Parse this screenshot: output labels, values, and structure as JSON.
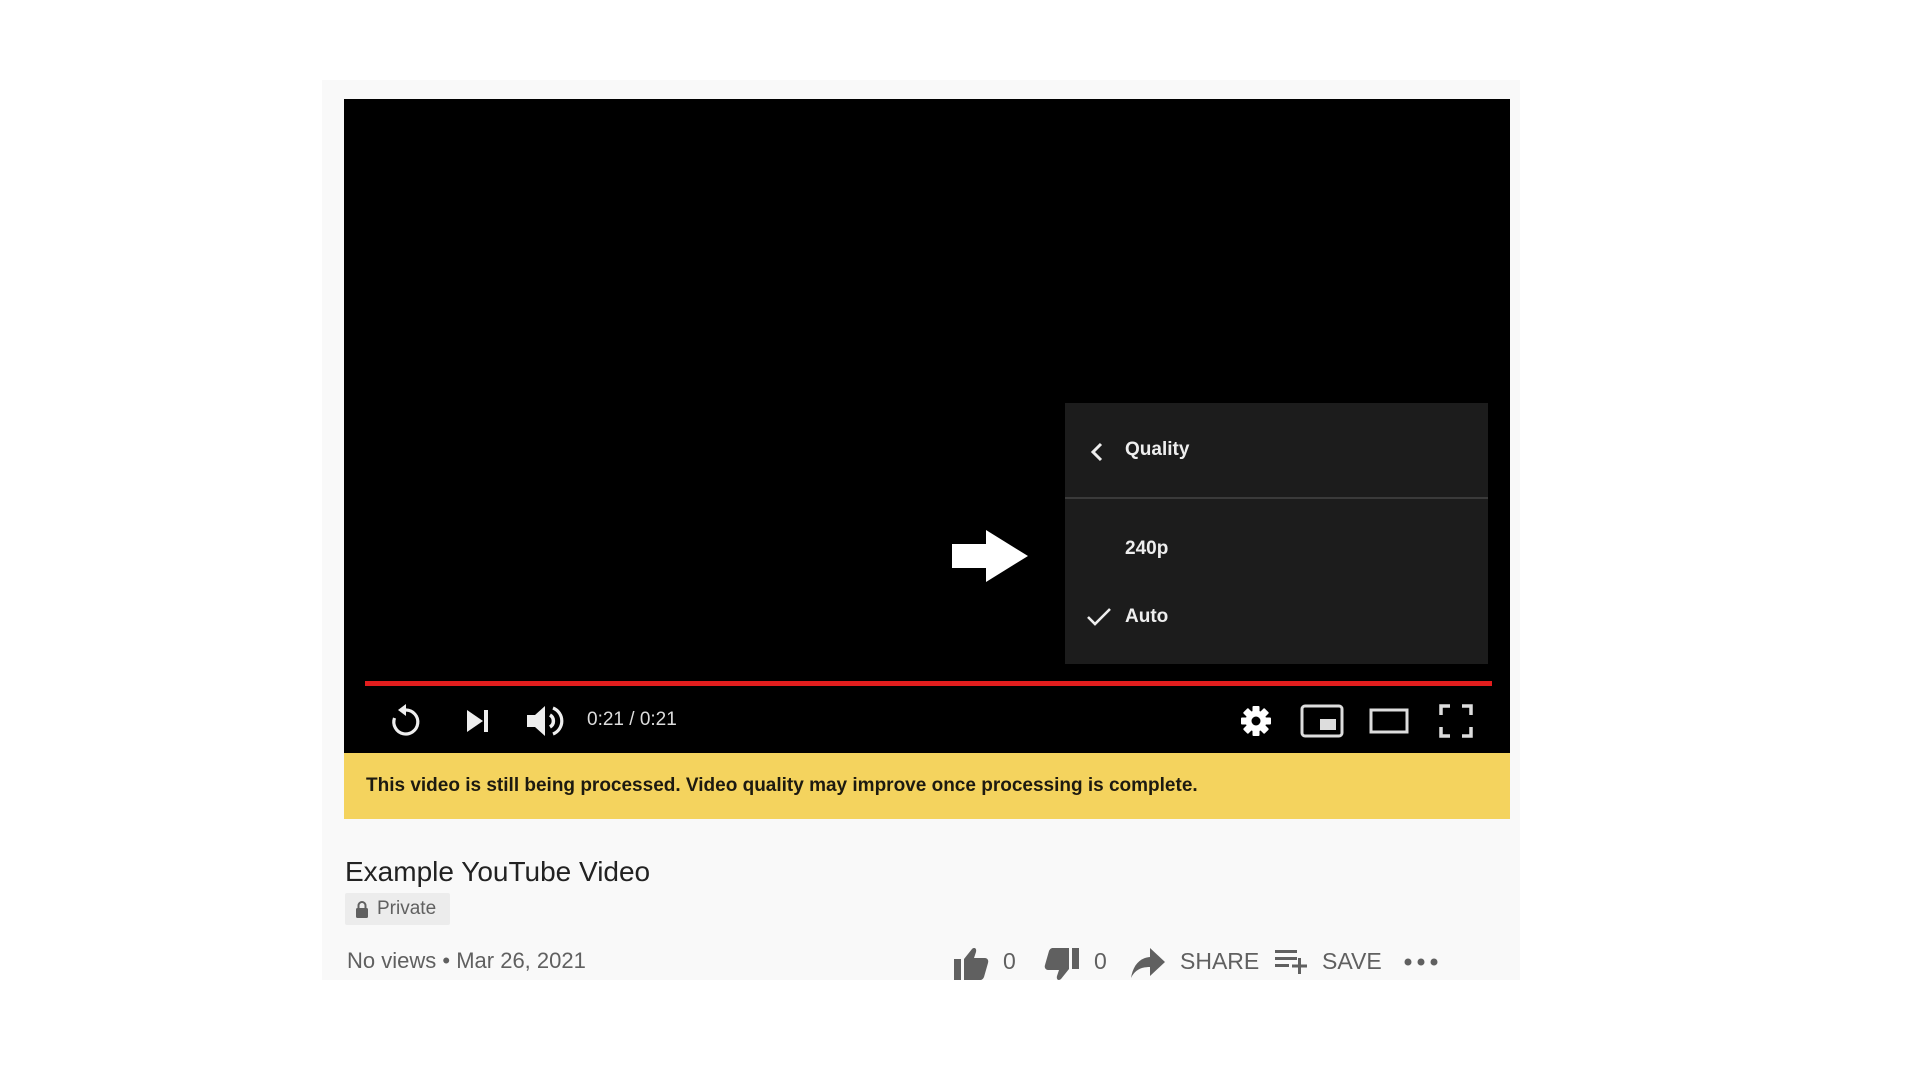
{
  "player": {
    "quality_menu": {
      "title": "Quality",
      "back_icon": "chevron-left-icon",
      "options": [
        {
          "label": "240p",
          "selected": false
        },
        {
          "label": "Auto",
          "selected": true
        }
      ]
    },
    "pointer_annotation": "arrow-right-icon",
    "progress": {
      "played_fraction": 1.0,
      "color": "#e21d1d"
    },
    "controls": {
      "replay_icon": "replay-icon",
      "next_icon": "skip-next-icon",
      "volume_icon": "volume-up-icon",
      "time": "0:21 / 0:21",
      "settings_icon": "gear-icon",
      "miniplayer_icon": "miniplayer-icon",
      "theater_icon": "theater-mode-icon",
      "fullscreen_icon": "fullscreen-icon"
    }
  },
  "notice": {
    "text": "This video is still being processed. Video quality may improve once processing is complete.",
    "color": "#f4d35e"
  },
  "video": {
    "title": "Example YouTube Video",
    "privacy": "Private",
    "views": "No views",
    "separator": "•",
    "date": "Mar 26, 2021"
  },
  "actions": {
    "like_count": "0",
    "dislike_count": "0",
    "share_label": "SHARE",
    "save_label": "SAVE"
  }
}
